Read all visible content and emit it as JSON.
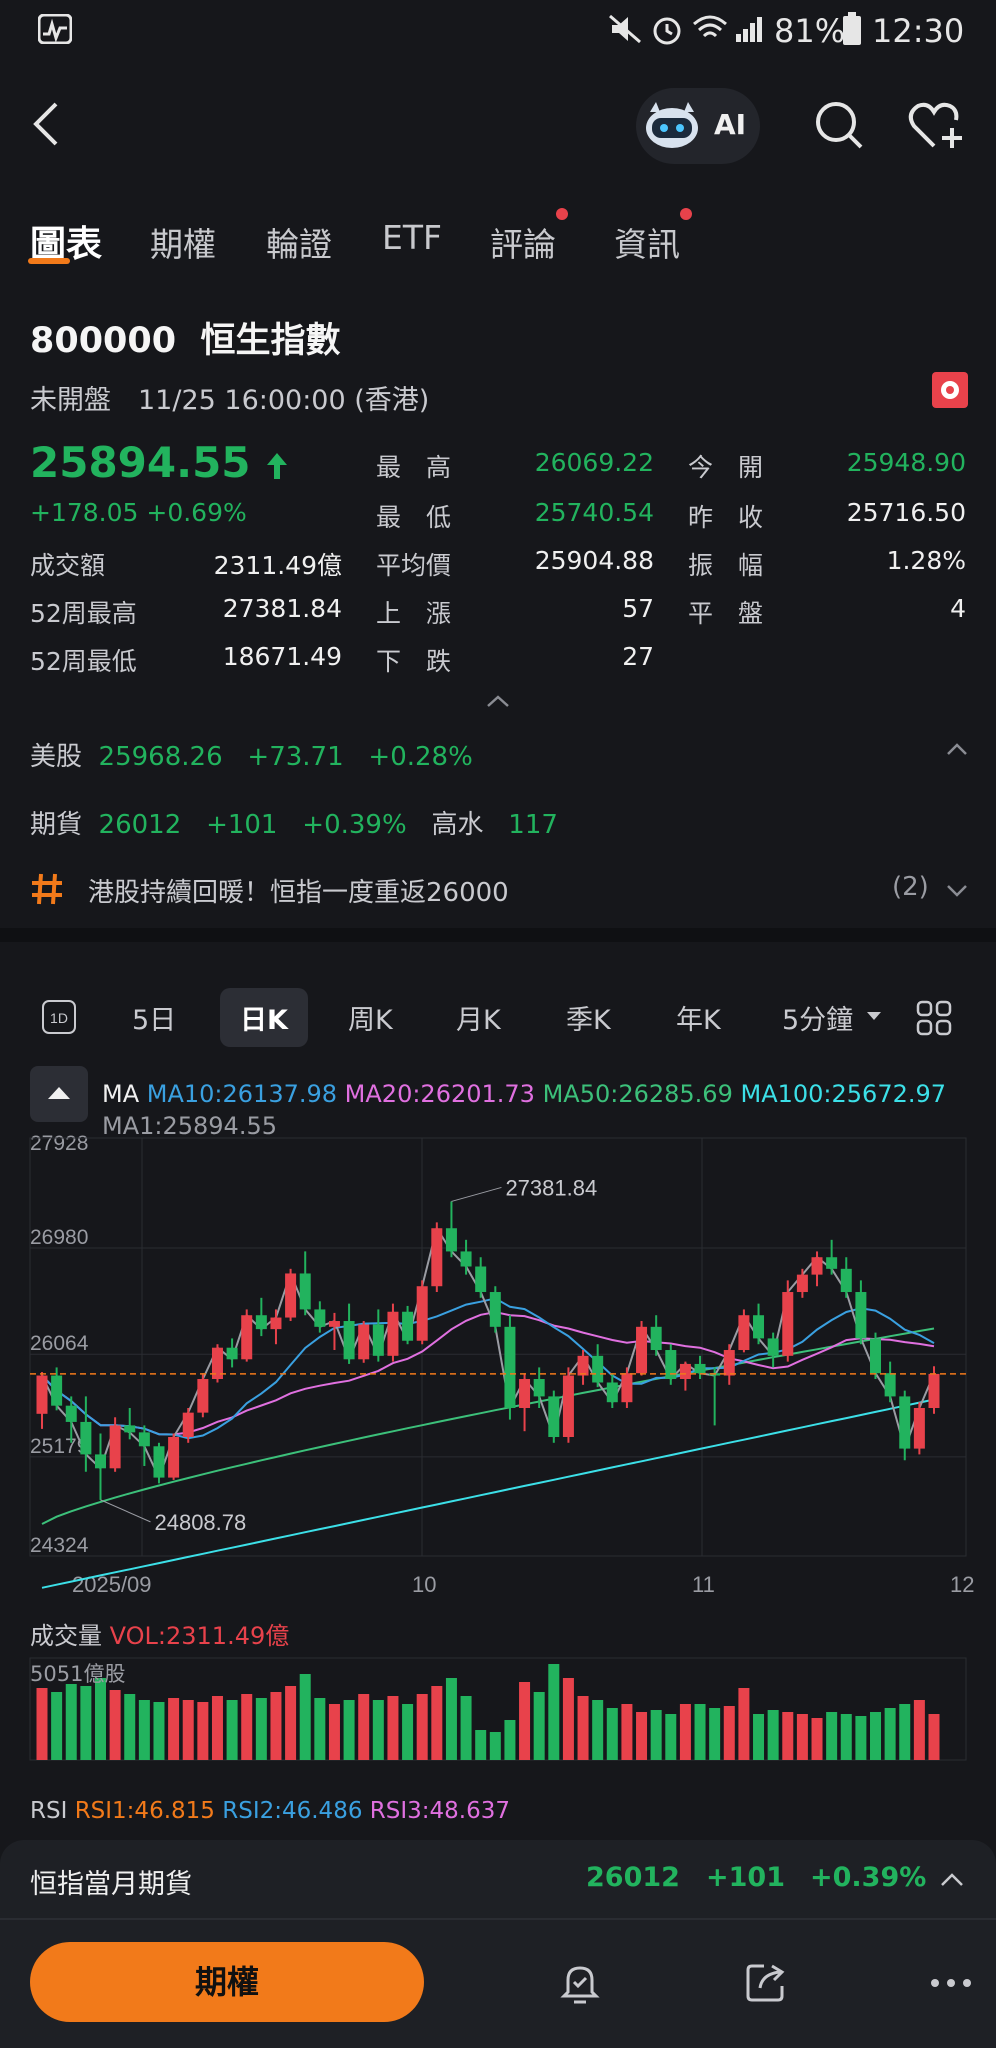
{
  "status": {
    "battery": "81%",
    "time": "12:30"
  },
  "header": {
    "ai_label": "AI"
  },
  "tabs": [
    {
      "label": "圖表",
      "dot": false
    },
    {
      "label": "期權",
      "dot": false
    },
    {
      "label": "輪證",
      "dot": false
    },
    {
      "label": "ETF",
      "dot": false
    },
    {
      "label": "評論",
      "dot": true
    },
    {
      "label": "資訊",
      "dot": true
    }
  ],
  "stock": {
    "code": "800000",
    "name": "恒生指數",
    "status_line": "未開盤　11/25 16:00:00 (香港)",
    "price": "25894.55",
    "change": "+178.05 +0.69%",
    "stats": {
      "high_label": "最　高",
      "high": "26069.22",
      "open_label": "今　開",
      "open": "25948.90",
      "low_label": "最　低",
      "low": "25740.54",
      "prev_label": "昨　收",
      "prev": "25716.50",
      "turnover_label": "成交額",
      "turnover": "2311.49億",
      "avg_label": "平均價",
      "avg": "25904.88",
      "amp_label": "振　幅",
      "amp": "1.28%",
      "wk52_high_label": "52周最高",
      "wk52_high": "27381.84",
      "up_label": "上　漲",
      "up": "57",
      "flat_label": "平　盤",
      "flat": "4",
      "wk52_low_label": "52周最低",
      "wk52_low": "18671.49",
      "down_label": "下　跌",
      "down": "27"
    }
  },
  "us_market": {
    "label": "美股",
    "value": "25968.26",
    "change": "+73.71",
    "pct": "+0.28%"
  },
  "futures_row": {
    "label": "期貨",
    "value": "26012",
    "change": "+101",
    "pct": "+0.39%",
    "premium_label": "高水",
    "premium": "117"
  },
  "news": {
    "text": "港股持續回暖！恒指一度重返26000",
    "count": "(2)"
  },
  "periods": [
    "5日",
    "日K",
    "周K",
    "月K",
    "季K",
    "年K",
    "5分鐘"
  ],
  "ma": {
    "label": "MA",
    "ma10": "MA10:26137.98",
    "ma20": "MA20:26201.73",
    "ma50": "MA50:26285.69",
    "ma100": "MA100:25672.97",
    "ma1": "MA1:25894.55"
  },
  "colors": {
    "up": "#e8424b",
    "down": "#22b35e",
    "ma10": "#3aa0e0",
    "ma20": "#e070e0",
    "ma50": "#3cc07a",
    "ma100": "#3ce0e8",
    "accent": "#f27a1a"
  },
  "chart_data": {
    "type": "candlestick",
    "y_ticks": [
      "27928",
      "26980",
      "26064",
      "25179",
      "24324"
    ],
    "x_ticks": [
      "2025/09",
      "10",
      "11",
      "12"
    ],
    "ylim": [
      24324,
      27928
    ],
    "annotations": {
      "high": "27381.84",
      "low": "24808.78"
    },
    "last_price": 25894.55,
    "ohlc": [
      [
        25550,
        25910,
        25420,
        25880
      ],
      [
        25880,
        25950,
        25580,
        25620
      ],
      [
        25620,
        25700,
        25300,
        25480
      ],
      [
        25480,
        25700,
        25050,
        25200
      ],
      [
        25200,
        25380,
        24808,
        25080
      ],
      [
        25080,
        25520,
        25050,
        25450
      ],
      [
        25450,
        25600,
        25330,
        25390
      ],
      [
        25390,
        25450,
        25100,
        25270
      ],
      [
        25270,
        25300,
        24950,
        25000
      ],
      [
        25000,
        25380,
        24980,
        25350
      ],
      [
        25350,
        25600,
        25300,
        25560
      ],
      [
        25560,
        25900,
        25520,
        25850
      ],
      [
        25850,
        26150,
        25820,
        26120
      ],
      [
        26120,
        26200,
        25950,
        26020
      ],
      [
        26020,
        26450,
        26000,
        26400
      ],
      [
        26400,
        26550,
        26220,
        26280
      ],
      [
        26280,
        26450,
        26150,
        26380
      ],
      [
        26380,
        26800,
        26350,
        26760
      ],
      [
        26760,
        26950,
        26400,
        26450
      ],
      [
        26450,
        26520,
        26250,
        26300
      ],
      [
        26300,
        26420,
        26100,
        26350
      ],
      [
        26350,
        26500,
        25980,
        26020
      ],
      [
        26020,
        26350,
        25990,
        26320
      ],
      [
        26320,
        26450,
        26000,
        26050
      ],
      [
        26050,
        26500,
        26000,
        26430
      ],
      [
        26430,
        26480,
        26150,
        26180
      ],
      [
        26180,
        26700,
        26150,
        26650
      ],
      [
        26650,
        27200,
        26600,
        27150
      ],
      [
        27150,
        27381,
        26900,
        26950
      ],
      [
        26950,
        27050,
        26750,
        26820
      ],
      [
        26820,
        26900,
        26550,
        26600
      ],
      [
        26600,
        26650,
        26250,
        26300
      ],
      [
        26300,
        26400,
        25500,
        25600
      ],
      [
        25600,
        25900,
        25400,
        25850
      ],
      [
        25850,
        25950,
        25600,
        25700
      ],
      [
        25700,
        25750,
        25300,
        25350
      ],
      [
        25350,
        25950,
        25300,
        25880
      ],
      [
        25880,
        26100,
        25800,
        26050
      ],
      [
        26050,
        26150,
        25780,
        25820
      ],
      [
        25820,
        25900,
        25600,
        25650
      ],
      [
        25650,
        25950,
        25600,
        25900
      ],
      [
        25900,
        26350,
        25880,
        26300
      ],
      [
        26300,
        26400,
        26050,
        26100
      ],
      [
        26100,
        26150,
        25800,
        25850
      ],
      [
        25850,
        26000,
        25750,
        25980
      ],
      [
        25980,
        26050,
        25850,
        25900
      ],
      [
        25900,
        25950,
        25450,
        25880
      ],
      [
        25880,
        26150,
        25800,
        26100
      ],
      [
        26100,
        26450,
        26080,
        26400
      ],
      [
        26400,
        26500,
        26150,
        26200
      ],
      [
        26200,
        26250,
        25950,
        26050
      ],
      [
        26050,
        26700,
        26000,
        26600
      ],
      [
        26600,
        26800,
        26550,
        26750
      ],
      [
        26750,
        26950,
        26650,
        26900
      ],
      [
        26900,
        27050,
        26750,
        26800
      ],
      [
        26800,
        26900,
        26550,
        26600
      ],
      [
        26600,
        26700,
        26150,
        26200
      ],
      [
        26200,
        26250,
        25850,
        25900
      ],
      [
        25900,
        26000,
        25650,
        25700
      ],
      [
        25700,
        25750,
        25150,
        25250
      ],
      [
        25250,
        25650,
        25200,
        25600
      ],
      [
        25600,
        25960,
        25550,
        25894
      ]
    ]
  },
  "volume": {
    "label": "成交量",
    "vol": "VOL:2311.49億",
    "max_label": "5051億股",
    "bars": [
      0.72,
      0.68,
      0.76,
      0.74,
      0.82,
      0.7,
      0.66,
      0.6,
      0.58,
      0.62,
      0.6,
      0.58,
      0.64,
      0.6,
      0.66,
      0.62,
      0.68,
      0.74,
      0.86,
      0.62,
      0.56,
      0.6,
      0.66,
      0.6,
      0.64,
      0.56,
      0.66,
      0.74,
      0.82,
      0.64,
      0.3,
      0.28,
      0.4,
      0.78,
      0.68,
      0.96,
      0.82,
      0.64,
      0.6,
      0.52,
      0.56,
      0.48,
      0.5,
      0.46,
      0.56,
      0.56,
      0.52,
      0.54,
      0.72,
      0.46,
      0.5,
      0.48,
      0.46,
      0.42,
      0.48,
      0.46,
      0.44,
      0.48,
      0.52,
      0.56,
      0.6,
      0.46
    ]
  },
  "rsi": {
    "label": "RSI",
    "rsi1": "RSI1:46.815",
    "rsi2": "RSI2:46.486",
    "rsi3": "RSI3:48.637"
  },
  "bottom_futures": {
    "label": "恒指當月期貨",
    "value": "26012",
    "change": "+101",
    "pct": "+0.39%"
  },
  "bottom_bar": {
    "options_label": "期權"
  }
}
